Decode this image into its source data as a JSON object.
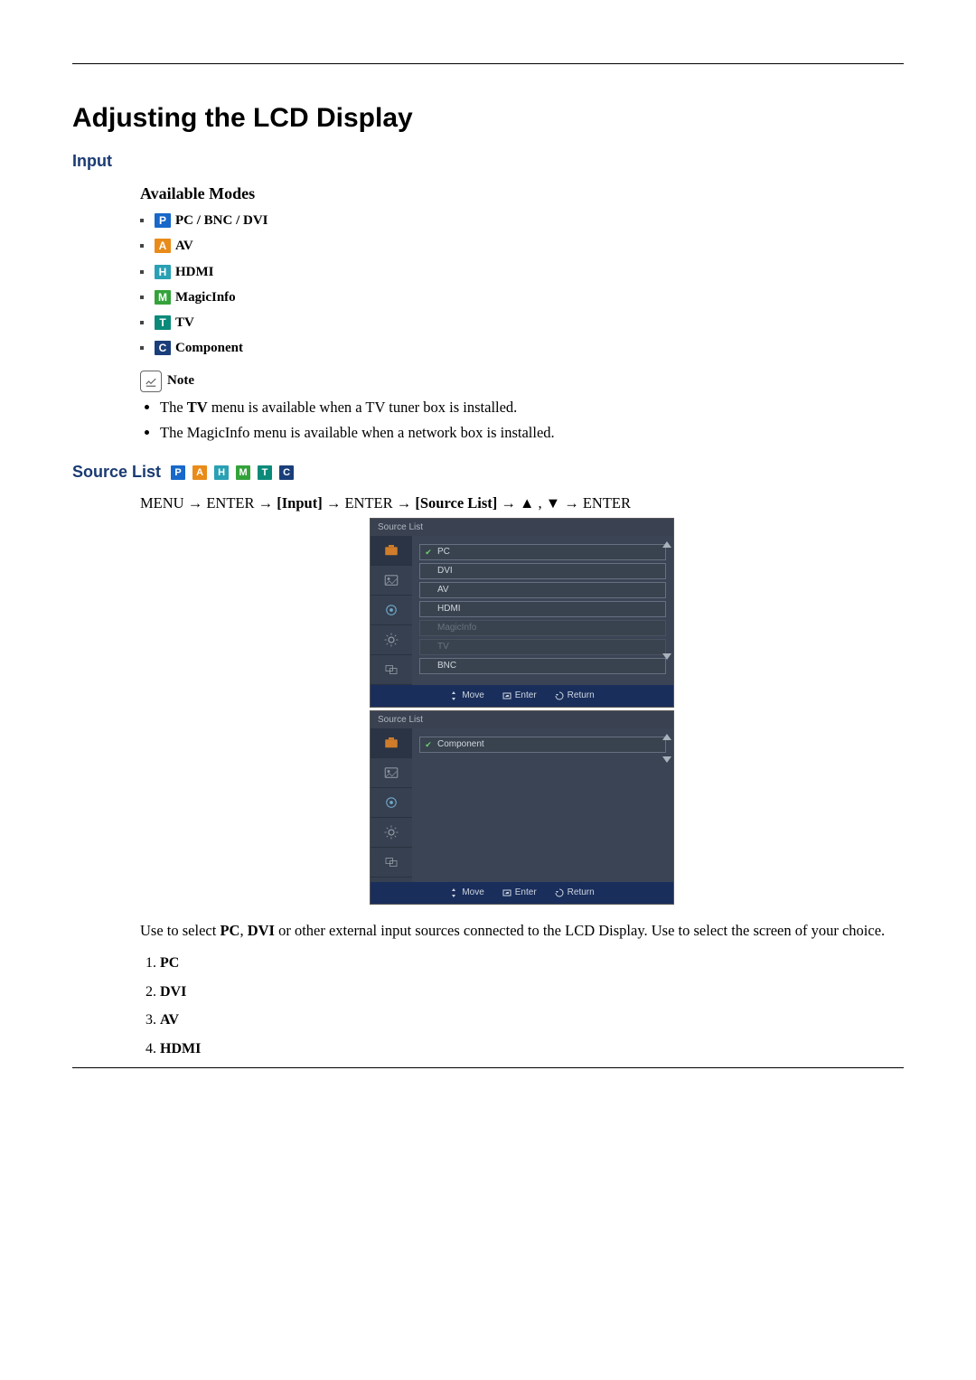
{
  "page_title": "Adjusting the LCD Display",
  "section_input": "Input",
  "sub_modes": "Available Modes",
  "modes": [
    {
      "icon": "P",
      "color": "mi-blue",
      "label": "PC / BNC / DVI"
    },
    {
      "icon": "A",
      "color": "mi-orange",
      "label": "AV"
    },
    {
      "icon": "H",
      "color": "mi-cyan",
      "label": "HDMI"
    },
    {
      "icon": "M",
      "color": "mi-green",
      "label": "MagicInfo"
    },
    {
      "icon": "T",
      "color": "mi-teal",
      "label": "TV"
    },
    {
      "icon": "C",
      "color": "mi-navy",
      "label": "Component"
    }
  ],
  "note_label": "Note",
  "notes": {
    "tv_pre": "The ",
    "tv_bold": "TV",
    "tv_post": " menu is available when a TV tuner box is installed.",
    "magic": "The MagicInfo menu is available when a network box is installed."
  },
  "source_list_title": "Source List",
  "nav": {
    "menu": "MENU",
    "arrow": "→",
    "enter": "ENTER",
    "input": "[Input]",
    "src": "[Source List]",
    "up": "▲",
    "down": "▼",
    "comma": ","
  },
  "osd": {
    "title": "Source List",
    "items1": [
      {
        "label": "PC",
        "checked": true,
        "dim": false
      },
      {
        "label": "DVI",
        "checked": false,
        "dim": false
      },
      {
        "label": "AV",
        "checked": false,
        "dim": false
      },
      {
        "label": "HDMI",
        "checked": false,
        "dim": false
      },
      {
        "label": "MagicInfo",
        "checked": false,
        "dim": true
      },
      {
        "label": "TV",
        "checked": false,
        "dim": true
      },
      {
        "label": "BNC",
        "checked": false,
        "dim": false
      }
    ],
    "items2": [
      {
        "label": "Component",
        "checked": true,
        "dim": false
      }
    ],
    "foot_move": "Move",
    "foot_enter": "Enter",
    "foot_return": "Return"
  },
  "description": {
    "pre": "Use to select ",
    "b1": "PC",
    "mid1": ", ",
    "b2": "DVI",
    "post": " or other external input sources connected to the LCD Display. Use to select the screen of your choice."
  },
  "final_list": [
    "PC",
    "DVI",
    "AV",
    "HDMI"
  ]
}
